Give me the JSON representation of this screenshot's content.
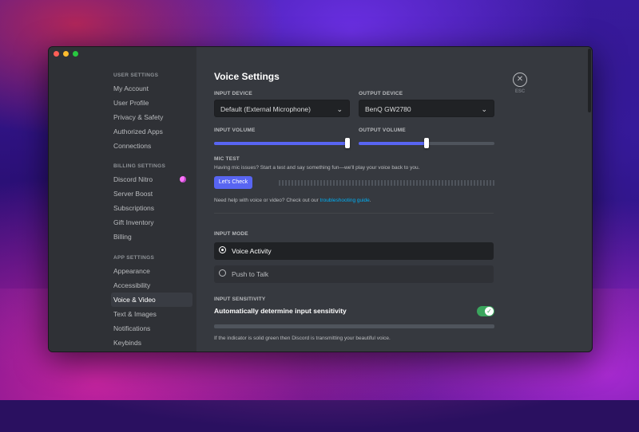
{
  "window": {
    "traffic_lights": [
      "#fe5f57",
      "#febc2e",
      "#28c840"
    ]
  },
  "sidebar": {
    "user_settings": {
      "header": "USER SETTINGS",
      "items": [
        "My Account",
        "User Profile",
        "Privacy & Safety",
        "Authorized Apps",
        "Connections"
      ]
    },
    "billing_settings": {
      "header": "BILLING SETTINGS",
      "items": [
        "Discord Nitro",
        "Server Boost",
        "Subscriptions",
        "Gift Inventory",
        "Billing"
      ]
    },
    "app_settings": {
      "header": "APP SETTINGS",
      "items": [
        "Appearance",
        "Accessibility",
        "Voice & Video",
        "Text & Images",
        "Notifications",
        "Keybinds"
      ],
      "active": "Voice & Video"
    }
  },
  "main": {
    "title": "Voice Settings",
    "input_device": {
      "label": "INPUT DEVICE",
      "value": "Default (External Microphone)"
    },
    "output_device": {
      "label": "OUTPUT DEVICE",
      "value": "BenQ GW2780"
    },
    "input_volume": {
      "label": "INPUT VOLUME",
      "level": 1.0
    },
    "output_volume": {
      "label": "OUTPUT VOLUME",
      "level": 0.5
    },
    "mic_test": {
      "label": "MIC TEST",
      "description": "Having mic issues? Start a test and say something fun—we'll play your voice back to you.",
      "button": "Let's Check"
    },
    "help": {
      "prefix": "Need help with voice or video? Check out our ",
      "link": "troubleshooting guide",
      "suffix": "."
    },
    "input_mode": {
      "label": "INPUT MODE",
      "options": [
        "Voice Activity",
        "Push to Talk"
      ],
      "selected": "Voice Activity"
    },
    "input_sensitivity": {
      "label": "INPUT SENSITIVITY",
      "auto_label": "Automatically determine input sensitivity",
      "auto_enabled": true,
      "note": "If the indicator is solid green then Discord is transmitting your beautiful voice."
    },
    "close": {
      "label": "ESC",
      "icon": "close-icon"
    }
  },
  "colors": {
    "accent": "#5865f2",
    "toggle_on": "#3ba55d",
    "link": "#00aff4"
  }
}
